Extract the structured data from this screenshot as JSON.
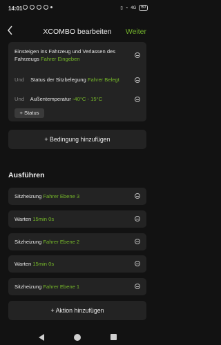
{
  "status_bar": {
    "time": "14:01",
    "signal": "4G",
    "battery": "60"
  },
  "header": {
    "title": "XCOMBO bearbeiten",
    "next": "Weiter",
    "back_icon": "chevron-left-icon"
  },
  "conditions": [
    {
      "prefix": "",
      "text": "Einsteigen ins Fahrzeug und Verlassen des Fahrzeugs",
      "value": "Fahrer Eingeben"
    },
    {
      "prefix": "Und",
      "text": "Status der Sitzbelegung",
      "value": "Fahrer Belegt"
    },
    {
      "prefix": "Und",
      "text": "Außentemperatur",
      "value": "-40°C - 15°C"
    }
  ],
  "status_button": "+ Status",
  "add_condition": "+ Bedingung hinzufügen",
  "actions_title": "Ausführen",
  "actions": [
    {
      "text": "Sitzheizung",
      "value": "Fahrer Ebene 3"
    },
    {
      "text": "Warten",
      "value": "15min 0s"
    },
    {
      "text": "Sitzheizung",
      "value": "Fahrer Ebene 2"
    },
    {
      "text": "Warten",
      "value": "15min 0s"
    },
    {
      "text": "Sitzheizung",
      "value": "Fahrer Ebene 1"
    }
  ],
  "add_action": "+ Aktion hinzufügen",
  "colors": {
    "accent": "#76b82a",
    "background": "#121212",
    "card": "#232323"
  }
}
